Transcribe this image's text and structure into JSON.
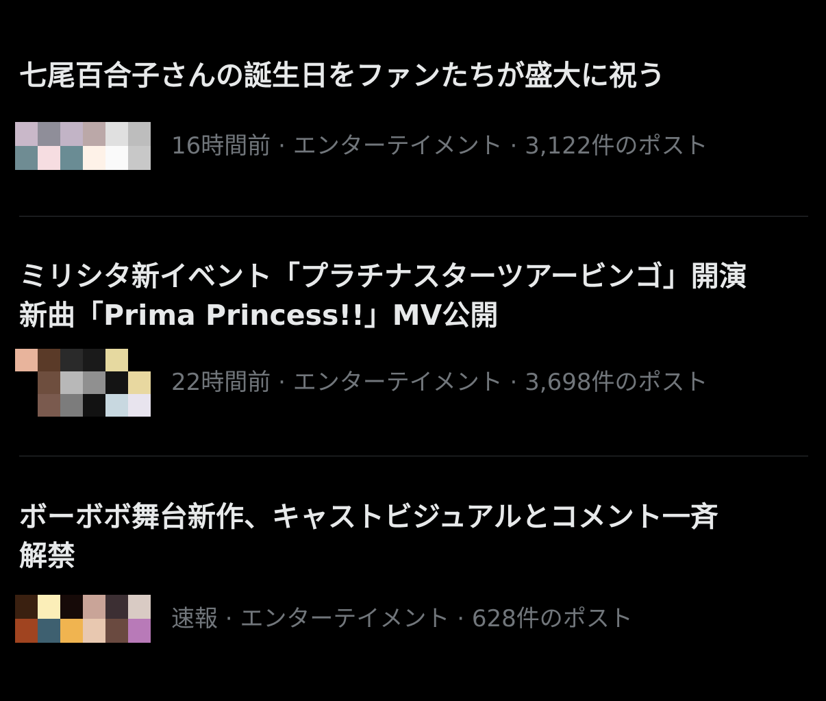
{
  "trends": [
    {
      "title": "七尾百合子さんの誕生日をファンたちが盛大に祝う",
      "time": "16時間前",
      "category": "エンターテイメント",
      "posts": "3,122件のポスト",
      "separator": " · ",
      "avatar_colors": [
        "#c9b8c9",
        "#8f8e99",
        "#c2b4c6",
        "#bba8a8",
        "#e0e0e0",
        "#bdbdbd",
        "#6f8c93",
        "#f6dde1",
        "#6a8c94",
        "#fef2e8",
        "#fafafa",
        "#c8c8c8"
      ]
    },
    {
      "title": "ミリシタ新イベント「プラチナスターツアービンゴ」開演\n新曲「Prima Princess!!」MV公開",
      "time": "22時間前",
      "category": "エンターテイメント",
      "posts": "3,698件のポスト",
      "separator": " · ",
      "avatar_colors": [
        "#e8b49c",
        "#5a3a28",
        "#2a2a2a",
        "#1a1a1a",
        "#e6d9a0",
        "#000000",
        "#000000",
        "#6e4e3e",
        "#b8b8b8",
        "#909090",
        "#141414",
        "#e8d8a0",
        "#000000",
        "#7a5a4e",
        "#7c7c7c",
        "#121212",
        "#c8d8e0",
        "#e8e4ee"
      ]
    },
    {
      "title": "ボーボボ舞台新作、キャストビジュアルとコメント一斉\n解禁",
      "time": "速報",
      "category": "エンターテイメント",
      "posts": "628件のポスト",
      "separator": " · ",
      "avatar_colors": [
        "#3a2010",
        "#fbeeb8",
        "#160a08",
        "#c9a498",
        "#3c2f33",
        "#d9cbc4",
        "#a04420",
        "#3e6070",
        "#f0b450",
        "#e8c8b0",
        "#6a4a40",
        "#b87ab8"
      ]
    }
  ]
}
